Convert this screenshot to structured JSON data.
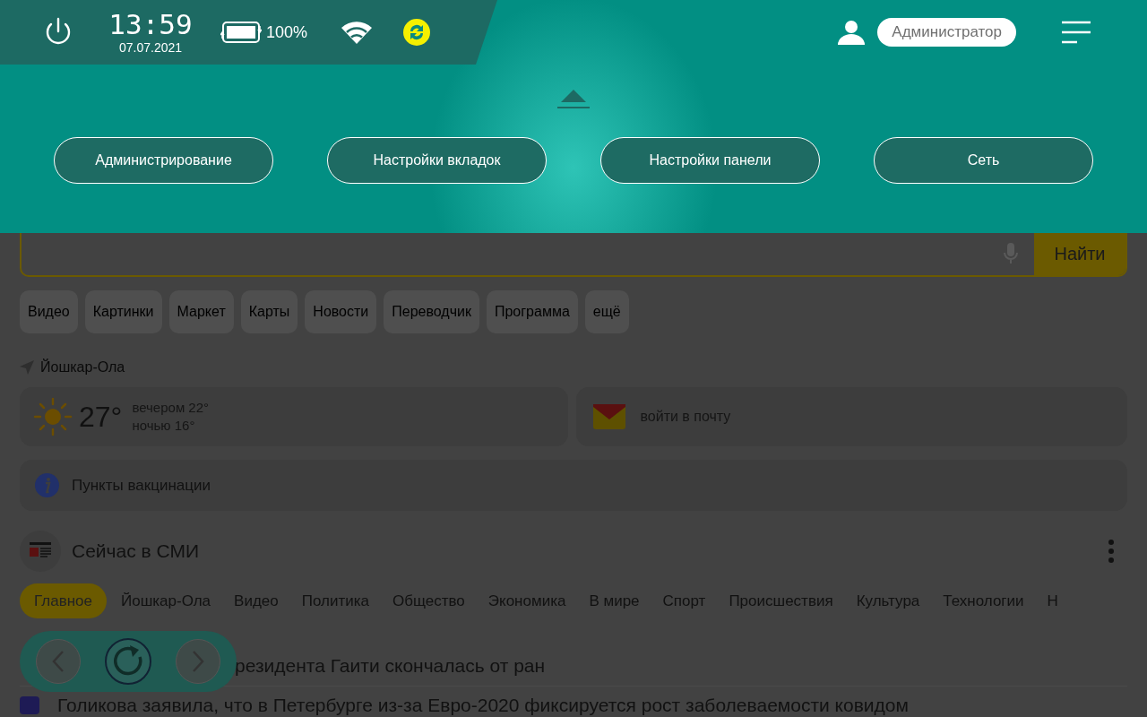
{
  "status_bar": {
    "time": "13:59",
    "date": "07.07.2021",
    "battery": "100%",
    "user": "Администратор"
  },
  "panel": {
    "buttons": [
      "Администрирование",
      "Настройки вкладок",
      "Настройки панели",
      "Сеть"
    ]
  },
  "search": {
    "button": "Найти"
  },
  "services": [
    "Видео",
    "Картинки",
    "Маркет",
    "Карты",
    "Новости",
    "Переводчик",
    "Программа",
    "ещё"
  ],
  "location": "Йошкар-Ола",
  "weather": {
    "temperature": "27°",
    "evening": "вечером 22°",
    "night": "ночью 16°"
  },
  "mail": {
    "label": "войти в почту"
  },
  "info": {
    "label": "Пункты вакцинации"
  },
  "news": {
    "title": "Сейчас в СМИ",
    "tabs": [
      {
        "label": "Главное",
        "selected": true
      },
      {
        "label": "Йошкар-Ола",
        "selected": false
      },
      {
        "label": "Видео",
        "selected": false
      },
      {
        "label": "Политика",
        "selected": false
      },
      {
        "label": "Общество",
        "selected": false
      },
      {
        "label": "Экономика",
        "selected": false
      },
      {
        "label": "В мире",
        "selected": false
      },
      {
        "label": "Спорт",
        "selected": false
      },
      {
        "label": "Происшествия",
        "selected": false
      },
      {
        "label": "Культура",
        "selected": false
      },
      {
        "label": "Технологии",
        "selected": false
      },
      {
        "label": "Н",
        "selected": false
      }
    ],
    "headlines": [
      {
        "text": "резидента Гаити скончалась от ран"
      },
      {
        "text": "Голикова заявила, что в Петербурге из-за Евро-2020 фиксируется рост заболеваемости ковидом",
        "color": "#1e1b55"
      }
    ]
  }
}
